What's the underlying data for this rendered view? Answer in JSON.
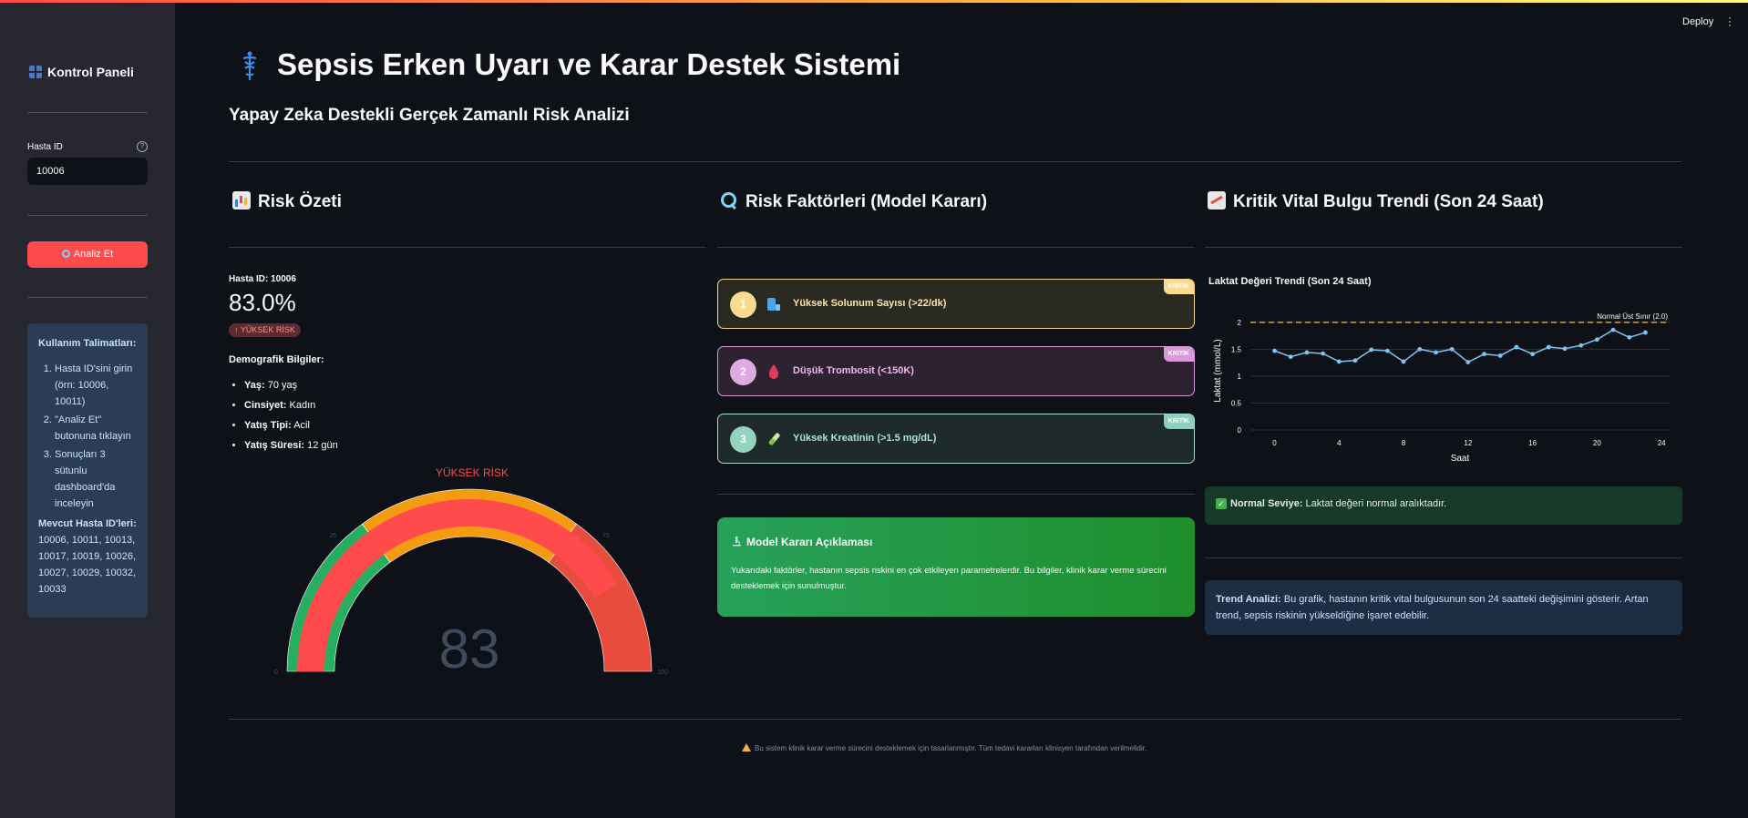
{
  "sidebar": {
    "title": "Kontrol Paneli",
    "patient_id_label": "Hasta ID",
    "patient_id_value": "10006",
    "analyze_button": "Analiz Et",
    "instructions_title": "Kullanım Talimatları:",
    "instructions": [
      "Hasta ID'sini girin (örn: 10006, 10011)",
      "\"Analiz Et\" butonuna tıklayın",
      "Sonuçları 3 sütunlu dashboard'da inceleyin"
    ],
    "available_ids_title": "Mevcut Hasta ID'leri:",
    "available_ids": "10006, 10011, 10013, 10017, 10019, 10026, 10027, 10029, 10032, 10033"
  },
  "header": {
    "deploy": "Deploy",
    "title": "Sepsis Erken Uyarı ve Karar Destek Sistemi",
    "subtitle": "Yapay Zeka Destekli Gerçek Zamanlı Risk Analizi"
  },
  "risk_summary": {
    "section_title": "Risk Özeti",
    "patient_label": "Hasta ID: 10006",
    "risk_percent": "83.0%",
    "risk_badge": "↑ YÜKSEK RİSK",
    "demographics_title": "Demografik Bilgiler:",
    "demographics": [
      {
        "key": "Yaş:",
        "value": " 70 yaş"
      },
      {
        "key": "Cinsiyet:",
        "value": " Kadın"
      },
      {
        "key": "Yatış Tipi:",
        "value": " Acil"
      },
      {
        "key": "Yatış Süresi:",
        "value": " 12 gün"
      }
    ],
    "gauge": {
      "label": "YÜKSEK RİSK",
      "value": 83,
      "value_text": "83",
      "min": 0,
      "max": 100,
      "ticks": [
        "0",
        "25",
        "50",
        "75",
        "100"
      ],
      "colors": {
        "low": "#27ae60",
        "mid": "#f39c12",
        "high": "#e74c3c",
        "bar": "#ff4b4b"
      }
    }
  },
  "risk_factors": {
    "section_title": "Risk Faktörleri (Model Kararı)",
    "items": [
      {
        "rank": "1",
        "label": "Yüksek Solunum Sayısı (>22/dk)",
        "badge": "KRİTİK",
        "icon": "lungs-icon"
      },
      {
        "rank": "2",
        "label": "Düşük Trombosit (<150K)",
        "badge": "KRİTİK",
        "icon": "drop-icon"
      },
      {
        "rank": "3",
        "label": "Yüksek Kreatinin (>1.5 mg/dL)",
        "badge": "KRİTİK",
        "icon": "test-tube-icon"
      }
    ],
    "explanation_title": "Model Kararı Açıklaması",
    "explanation_text": "Yukarıdaki faktörler, hastanın sepsis riskini en çok etkileyen parametrelerdir. Bu bilgiler, klinik karar verme sürecini desteklemek için sunulmuştur."
  },
  "vital_trend": {
    "section_title": "Kritik Vital Bulgu Trendi (Son 24 Saat)",
    "status_bold": "Normal Seviye:",
    "status_text": " Laktat değeri normal aralıktadır.",
    "analysis_bold": "Trend Analizi:",
    "analysis_text": " Bu grafik, hastanın kritik vital bulgusunun son 24 saatteki değişimini gösterir. Artan trend, sepsis riskinin yükseldiğine işaret edebilir."
  },
  "chart_data": {
    "type": "line",
    "title": "Laktat Değeri Trendi (Son 24 Saat)",
    "xlabel": "Saat",
    "ylabel": "Laktat (mmol/L)",
    "xlim": [
      -1.5,
      24.5
    ],
    "ylim": [
      0,
      2.2
    ],
    "xticks": [
      0,
      4,
      8,
      12,
      16,
      20,
      24
    ],
    "yticks": [
      0,
      0.5,
      1,
      1.5,
      2
    ],
    "threshold": {
      "value": 2.0,
      "label": "Normal Üst Sınır (2.0)",
      "color": "#f39c12"
    },
    "series": [
      {
        "color": "#7cc4f5",
        "x": [
          0,
          1,
          2,
          3,
          4,
          5,
          6,
          7,
          8,
          9,
          10,
          11,
          12,
          13,
          14,
          15,
          16,
          17,
          18,
          19,
          20,
          21,
          22,
          23
        ],
        "y": [
          1.47,
          1.36,
          1.44,
          1.42,
          1.27,
          1.29,
          1.49,
          1.47,
          1.27,
          1.5,
          1.44,
          1.5,
          1.26,
          1.41,
          1.38,
          1.54,
          1.41,
          1.54,
          1.51,
          1.57,
          1.68,
          1.86,
          1.72,
          1.81
        ]
      }
    ]
  },
  "footer": {
    "text": "Bu sistem klinik karar verme sürecini desteklemek için tasarlanmıştır. Tüm tedavi kararları klinisyen tarafından verilmelidir."
  }
}
